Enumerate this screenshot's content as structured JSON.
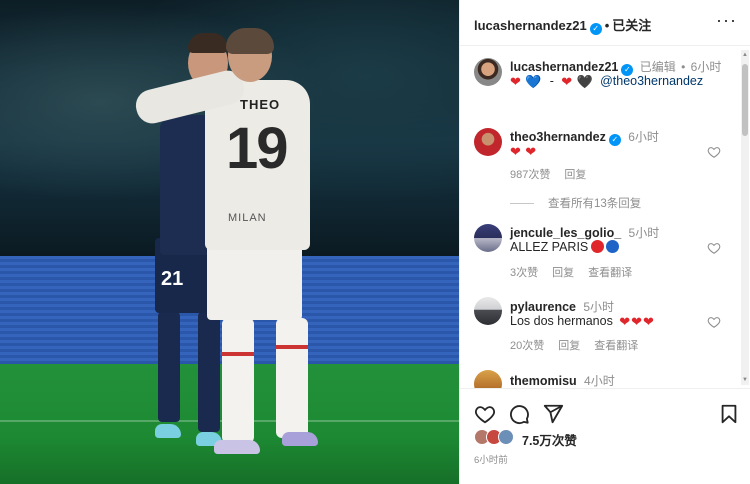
{
  "header": {
    "username": "lucashernandez21",
    "verified": true,
    "separator": "•",
    "follow_status": "已关注",
    "more": "···"
  },
  "caption": {
    "username": "lucashernandez21",
    "edited": "已编辑",
    "separator": "•",
    "time": "6小时",
    "emojis": [
      "❤",
      "💙",
      "-",
      "❤",
      "🖤"
    ],
    "mention": "@theo3hernandez"
  },
  "comments": [
    {
      "username": "theo3hernandez",
      "verified": true,
      "time": "6小时",
      "text_emojis": [
        "❤",
        "❤"
      ],
      "likes": "987次赞",
      "reply": "回复",
      "view_replies": "查看所有13条回复"
    },
    {
      "username": "jencule_les_golio_",
      "time": "5小时",
      "text": "ALLEZ PARIS",
      "likes": "3次赞",
      "reply": "回复",
      "translate": "查看翻译"
    },
    {
      "username": "pylaurence",
      "time": "5小时",
      "text": "Los dos hermanos",
      "likes": "20次赞",
      "reply": "回复",
      "translate": "查看翻译"
    },
    {
      "username": "themomisu",
      "time": "4小时"
    }
  ],
  "photo": {
    "player_name": "THEO",
    "player_number": "19",
    "sponsor": "MILAN",
    "other_number": "21"
  },
  "actions": {
    "likes": "7.5万次赞",
    "posted": "6小时前"
  },
  "colors": {
    "accent": "#0095f6",
    "heart_red": "#e0262b",
    "blue": "#1e63c6"
  }
}
